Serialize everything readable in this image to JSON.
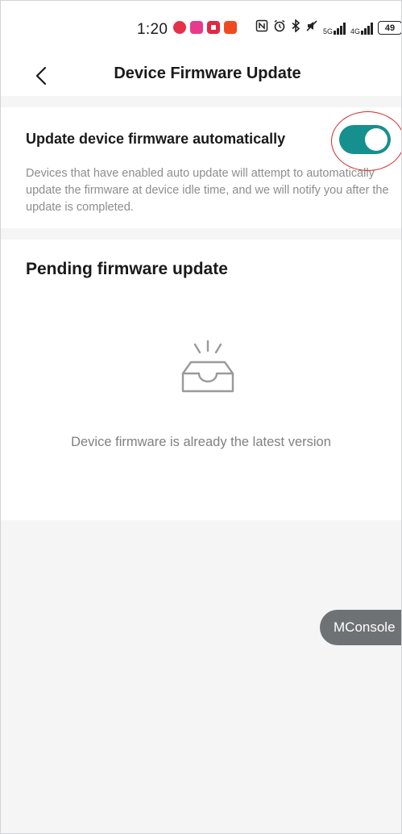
{
  "status_bar": {
    "time": "1:20",
    "app_icons": [
      "app-notification-icon",
      "app-notification-icon",
      "app-notification-icon",
      "app-notification-icon"
    ],
    "network_5g": "5G",
    "network_4g": "4G",
    "battery_level": "49"
  },
  "nav": {
    "title": "Device Firmware Update"
  },
  "auto_update": {
    "title": "Update device firmware automatically",
    "enabled": true,
    "toggle_color": "#16908e",
    "description": "Devices that have enabled auto update will attempt to automatically update the firmware at device idle time, and we will notify you after the update is completed."
  },
  "pending": {
    "title": "Pending firmware update",
    "empty_icon": "empty-inbox-icon",
    "empty_message": "Device firmware is already the latest version"
  },
  "floating": {
    "mconsole_label": "MConsole"
  }
}
